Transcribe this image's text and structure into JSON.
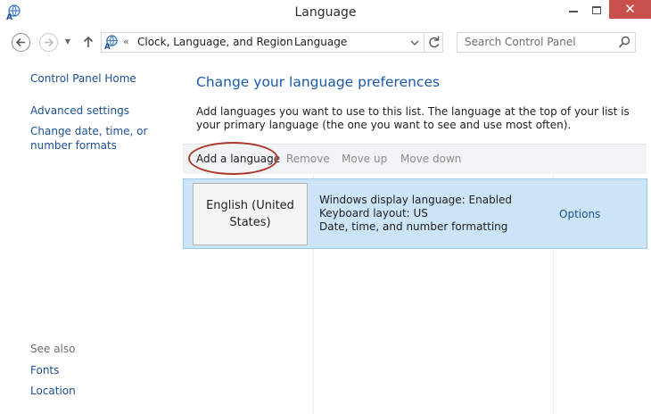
{
  "window": {
    "title": "Language",
    "close_glyph": "✕"
  },
  "nav": {
    "breadcrumb_sep": "«",
    "breadcrumbs": [
      "Clock, Language, and Region",
      "Language"
    ],
    "crumb_arrow": "›",
    "recent_glyph": "▼"
  },
  "search": {
    "placeholder": "Search Control Panel"
  },
  "sidebar": {
    "home": "Control Panel Home",
    "links": [
      "Advanced settings",
      "Change date, time, or number formats"
    ],
    "see_also_label": "See also",
    "see_also_links": [
      "Fonts",
      "Location"
    ]
  },
  "main": {
    "title": "Change your language preferences",
    "description": "Add languages you want to use to this list. The language at the top of your list is your primary language (the one you want to see and use most often).",
    "toolbar": {
      "add": "Add a language",
      "remove": "Remove",
      "move_up": "Move up",
      "move_down": "Move down"
    },
    "languages": [
      {
        "name": "English (United States)",
        "details": [
          "Windows display language: Enabled",
          "Keyboard layout: US",
          "Date, time, and number formatting"
        ],
        "options_label": "Options"
      }
    ]
  },
  "colors": {
    "link": "#1a4f96",
    "title_blue": "#1a5aa8",
    "selection": "#cce4f7",
    "selection_border": "#99c9ef",
    "close_red": "#c7504b",
    "annotation": "#a93a2a"
  },
  "icons": {
    "app": "language-globe-icon",
    "back": "back-arrow-icon",
    "forward": "forward-arrow-icon",
    "up": "up-arrow-icon",
    "refresh": "refresh-icon",
    "search": "search-icon"
  }
}
